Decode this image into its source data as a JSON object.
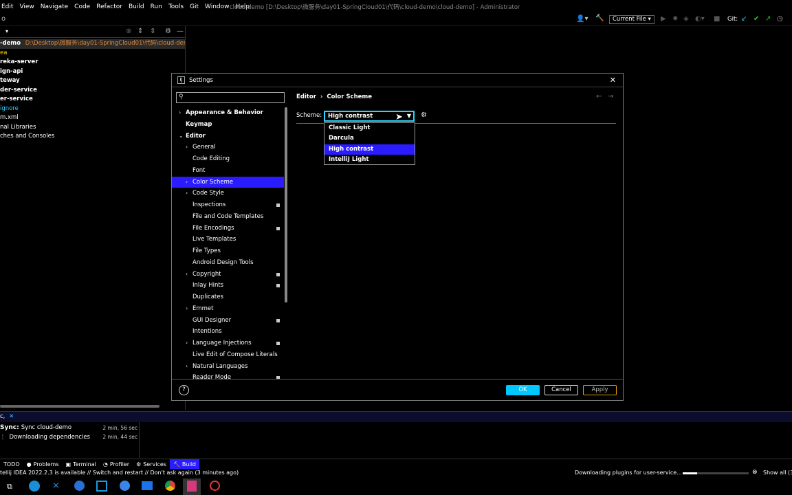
{
  "menubar": {
    "items": [
      "Edit",
      "View",
      "Navigate",
      "Code",
      "Refactor",
      "Build",
      "Run",
      "Tools",
      "Git",
      "Window",
      "Help"
    ],
    "window_title": "cloud-demo [D:\\Desktop\\微服务\\day01-SpringCloud01\\代码\\cloud-demo\\cloud-demo] - Administrator"
  },
  "toolbar": {
    "run_config": "Current File",
    "git_label": "Git:"
  },
  "project": {
    "root_name": "-demo",
    "root_path": "D:\\Desktop\\微服务\\day01-SpringCloud01\\代码\\cloud-demo\\cl",
    "items": [
      {
        "label": "ea",
        "style": "yellow"
      },
      {
        "label": "reka-server",
        "style": "bold"
      },
      {
        "label": "ign-api",
        "style": "bold"
      },
      {
        "label": "teway",
        "style": "bold"
      },
      {
        "label": "der-service",
        "style": "bold"
      },
      {
        "label": "er-service",
        "style": "bold"
      },
      {
        "label": "ignore",
        "style": "blue"
      },
      {
        "label": "m.xml",
        "style": "normal"
      },
      {
        "label": "nal Libraries",
        "style": "normal"
      },
      {
        "label": "ches and Consoles",
        "style": "normal"
      }
    ]
  },
  "dialog": {
    "title": "Settings",
    "breadcrumb": {
      "parent": "Editor",
      "sep": "›",
      "current": "Color Scheme"
    },
    "scheme_label": "Scheme:",
    "scheme_value": "High contrast",
    "scheme_options": [
      "Classic Light",
      "Darcula",
      "High contrast",
      "IntelliJ Light"
    ],
    "selected_option_index": 2,
    "tree": [
      {
        "label": "Appearance & Behavior",
        "level": 0,
        "chevron": "right",
        "bold": true
      },
      {
        "label": "Keymap",
        "level": 0,
        "bold": true
      },
      {
        "label": "Editor",
        "level": 0,
        "chevron": "down",
        "bold": true
      },
      {
        "label": "General",
        "level": 1,
        "chevron": "right"
      },
      {
        "label": "Code Editing",
        "level": 1
      },
      {
        "label": "Font",
        "level": 1
      },
      {
        "label": "Color Scheme",
        "level": 1,
        "chevron": "right",
        "selected": true
      },
      {
        "label": "Code Style",
        "level": 1,
        "chevron": "right"
      },
      {
        "label": "Inspections",
        "level": 1,
        "mark": true
      },
      {
        "label": "File and Code Templates",
        "level": 1
      },
      {
        "label": "File Encodings",
        "level": 1,
        "mark": true
      },
      {
        "label": "Live Templates",
        "level": 1
      },
      {
        "label": "File Types",
        "level": 1
      },
      {
        "label": "Android Design Tools",
        "level": 1
      },
      {
        "label": "Copyright",
        "level": 1,
        "chevron": "right",
        "mark": true
      },
      {
        "label": "Inlay Hints",
        "level": 1,
        "mark": true
      },
      {
        "label": "Duplicates",
        "level": 1
      },
      {
        "label": "Emmet",
        "level": 1,
        "chevron": "right"
      },
      {
        "label": "GUI Designer",
        "level": 1,
        "mark": true
      },
      {
        "label": "Intentions",
        "level": 1
      },
      {
        "label": "Language Injections",
        "level": 1,
        "chevron": "right",
        "mark": true
      },
      {
        "label": "Live Edit of Compose Literals",
        "level": 1
      },
      {
        "label": "Natural Languages",
        "level": 1,
        "chevron": "right"
      },
      {
        "label": "Reader Mode",
        "level": 1,
        "mark": true
      }
    ],
    "buttons": {
      "ok": "OK",
      "cancel": "Cancel",
      "apply": "Apply"
    }
  },
  "build": {
    "tab_label": "c,",
    "rows": [
      {
        "label": "Sync:",
        "text": "Sync cloud-demo",
        "time": "2 min, 56 sec"
      },
      {
        "label": "",
        "text": "Downloading dependencies",
        "time": "2 min, 44 sec"
      }
    ]
  },
  "toolwindows": [
    "TODO",
    "Problems",
    "Terminal",
    "Profiler",
    "Services",
    "Build"
  ],
  "status": {
    "left": "tellij IDEA 2022.2.3 is available // Switch and restart // Don't ask again (3 minutes ago)",
    "right": "Downloading plugins for user-service...",
    "show_all": "Show all (3"
  },
  "colors": {
    "accent_blue": "#2a1cff",
    "focus_cyan": "#2ad6ff",
    "ok_button": "#00c8ff",
    "apply_border": "#e0a000"
  }
}
